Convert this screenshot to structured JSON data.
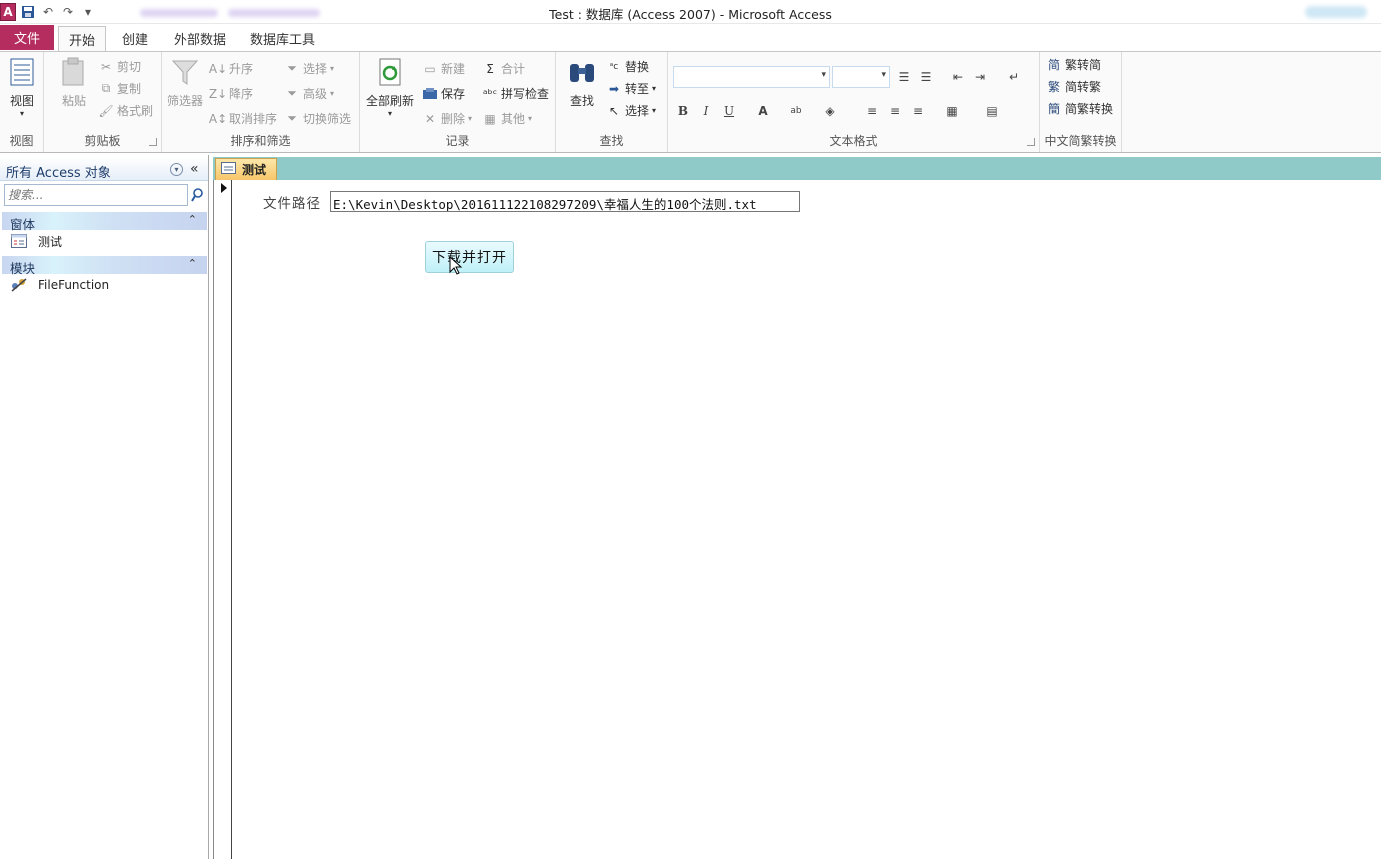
{
  "window": {
    "title": "Test : 数据库 (Access 2007)  -  Microsoft Access",
    "app_icon_letter": "A"
  },
  "tabs": {
    "file": "文件",
    "items": [
      "开始",
      "创建",
      "外部数据",
      "数据库工具"
    ],
    "active_index": 0
  },
  "ribbon": {
    "view": {
      "view_label": "视图",
      "group_label": "视图"
    },
    "clipboard": {
      "paste": "粘贴",
      "cut": "剪切",
      "copy": "复制",
      "format_painter": "格式刷",
      "group_label": "剪贴板"
    },
    "sort_filter": {
      "filter": "筛选器",
      "ascending": "升序",
      "descending": "降序",
      "remove_sort": "取消排序",
      "selection": "选择",
      "advanced": "高级",
      "toggle_filter": "切换筛选",
      "group_label": "排序和筛选"
    },
    "records": {
      "refresh_all": "全部刷新",
      "new": "新建",
      "save": "保存",
      "delete": "删除",
      "totals": "合计",
      "spelling": "拼写检查",
      "more": "其他",
      "group_label": "记录"
    },
    "find": {
      "find": "查找",
      "replace": "替换",
      "goto": "转至",
      "select": "选择",
      "group_label": "查找"
    },
    "text_format": {
      "group_label": "文本格式",
      "bold": "B",
      "italic": "I",
      "underline": "U",
      "font_color_letter": "A",
      "highlight_letters": "ab"
    },
    "chinese": {
      "to_simplified": "繁转简",
      "to_traditional": "简转繁",
      "convert": "简繁转换",
      "group_label": "中文简繁转换"
    }
  },
  "nav": {
    "title": "所有 Access 对象",
    "search_placeholder": "搜索...",
    "categories": [
      {
        "label": "窗体",
        "items": [
          "测试"
        ]
      },
      {
        "label": "模块",
        "items": [
          "FileFunction"
        ]
      }
    ]
  },
  "document": {
    "tab_label": "测试",
    "field_label": "文件路径",
    "field_value": "E:\\Kevin\\Desktop\\201611122108297209\\幸福人生的100个法则.txt",
    "button_label": "下载并打开"
  },
  "colors": {
    "file_tab": "#b52d5f",
    "doc_tabstrip": "#8fcac8",
    "doc_tab": "#f6c66a",
    "button": "#bff0f8"
  }
}
